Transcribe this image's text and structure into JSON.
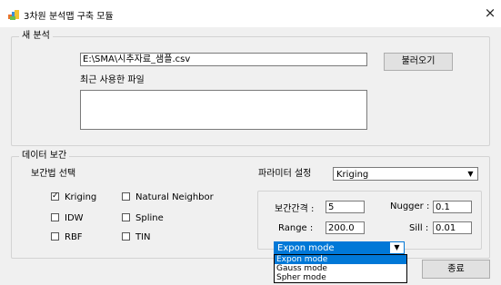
{
  "window": {
    "title": "3차원 분석맵 구축 모듈",
    "close_glyph": "×",
    "icon": "app-icon"
  },
  "new_analysis": {
    "legend": "새 분석",
    "file_path": "E:\\SMA\\시추자료_샘플.csv",
    "load_button": "불러오기",
    "recent_label": "최근 사용한 파일",
    "recent_files": ""
  },
  "interpolation": {
    "legend": "데이터 보간",
    "method_label": "보간법 선택",
    "methods": [
      {
        "label": "Kriging",
        "checked": true
      },
      {
        "label": "Natural Neighbor",
        "checked": false
      },
      {
        "label": "IDW",
        "checked": false
      },
      {
        "label": "Spline",
        "checked": false
      },
      {
        "label": "RBF",
        "checked": false
      },
      {
        "label": "TIN",
        "checked": false
      }
    ],
    "param_label": "파라미터 설정",
    "param_selected": "Kriging",
    "params": {
      "interval_label": "보간간격 :",
      "interval_value": "5",
      "nugget_label": "Nugger :",
      "nugget_value": "0.1",
      "range_label": "Range :",
      "range_value": "200.0",
      "sill_label": "Sill :",
      "sill_value": "0.01",
      "model_selected": "Expon mode",
      "model_options": [
        "Expon mode",
        "Gauss mode",
        "Spher mode"
      ]
    }
  },
  "footer": {
    "close_button": "종료"
  },
  "colors": {
    "accent": "#0078d7",
    "dialog_bg": "#f0f0f0"
  }
}
